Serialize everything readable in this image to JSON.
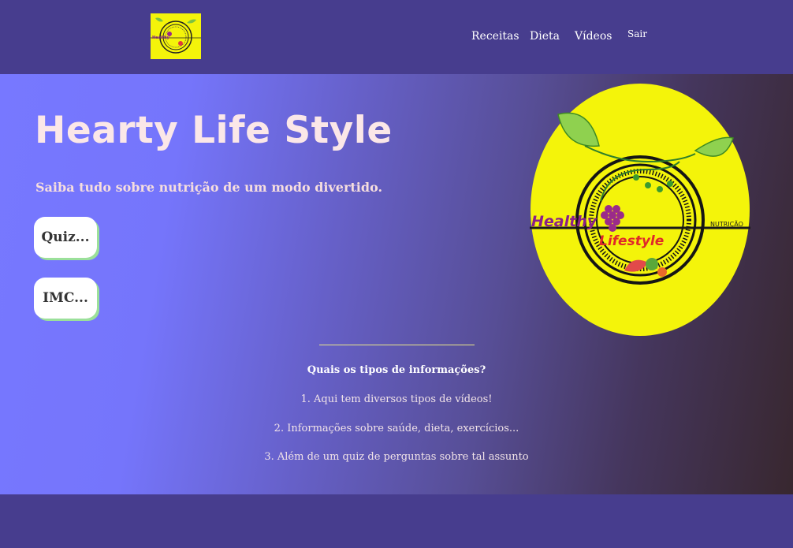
{
  "header": {
    "logo_icon": "healthy-lifestyle-logo-icon",
    "nav": [
      {
        "label": "Receitas"
      },
      {
        "label": "Dieta"
      },
      {
        "label": "Vídeos"
      },
      {
        "label": "Sair"
      }
    ]
  },
  "hero": {
    "title": "Hearty Life Style",
    "subtitle": "Saiba tudo sobre nutrição de um modo divertido.",
    "buttons": {
      "quiz": "Quiz...",
      "imc": "IMC..."
    },
    "logo": {
      "word_left": "Healthy",
      "word_center": "Lifestyle",
      "word_right": "NUTRIÇÃO"
    }
  },
  "info": {
    "question": "Quais os tipos de informações?",
    "items": [
      "1. Aqui tem diversos tipos de vídeos!",
      "2. Informações sobre saúde, dieta, exercícios...",
      "3. Além de um quiz de perguntas sobre tal assunto"
    ]
  },
  "colors": {
    "header_bg": "#473d8e",
    "gradient_start": "#7778ff",
    "gradient_end": "#38272f",
    "logo_yellow": "#f4f40a",
    "button_shadow": "#9be09a"
  }
}
